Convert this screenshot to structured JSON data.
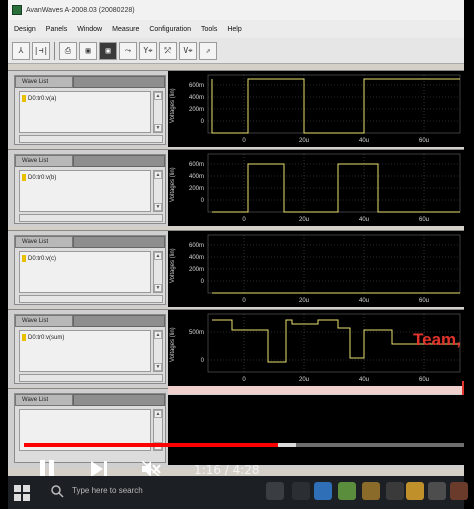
{
  "window": {
    "title": "AvanWaves A-2008.03 (20080228)"
  },
  "menu": [
    "Design",
    "Panels",
    "Window",
    "Measure",
    "Configuration",
    "Tools",
    "Help"
  ],
  "toolbar": {
    "buttons": [
      {
        "icon": "design-icon",
        "glyph": "⅄"
      },
      {
        "icon": "measure-icon",
        "glyph": "|⊣|"
      },
      {
        "icon": "printer-icon",
        "glyph": "⎙"
      },
      {
        "icon": "panel-icon",
        "glyph": "▣"
      },
      {
        "icon": "panel-dark-icon",
        "glyph": "▣"
      },
      {
        "icon": "probe-icon",
        "glyph": "⤳"
      },
      {
        "icon": "marker-y-icon",
        "glyph": "Y⌖"
      },
      {
        "icon": "marker-x-icon",
        "glyph": "⤱"
      },
      {
        "icon": "marker-v-icon",
        "glyph": "V⌖"
      },
      {
        "icon": "pointer-icon",
        "glyph": "⇗"
      }
    ]
  },
  "panels": [
    {
      "wave_list_label": "Wave List",
      "signal": "D0:tr0:v(a)",
      "ylabel": "Voltages (lin)",
      "yticks": [
        "600m",
        "400m",
        "200m",
        "0"
      ],
      "xticks": [
        "0",
        "20u",
        "40u",
        "60u"
      ]
    },
    {
      "wave_list_label": "Wave List",
      "signal": "D0:tr0:v(b)",
      "ylabel": "Voltages (lin)",
      "yticks": [
        "600m",
        "400m",
        "200m",
        "0"
      ],
      "xticks": [
        "0",
        "20u",
        "40u",
        "60u"
      ]
    },
    {
      "wave_list_label": "Wave List",
      "signal": "D0:tr0:v(c)",
      "ylabel": "Voltages (lin)",
      "yticks": [
        "600m",
        "400m",
        "200m",
        "0"
      ],
      "xticks": [
        "0",
        "20u",
        "40u",
        "60u"
      ]
    },
    {
      "wave_list_label": "Wave List",
      "signal": "D0:tr0:v(sum)",
      "ylabel": "Voltages (lin)",
      "yticks": [
        "500m",
        "0"
      ],
      "xticks": [
        "0",
        "20u",
        "40u",
        "60u"
      ]
    },
    {
      "wave_list_label": "Wave List",
      "signal": "",
      "ylabel": "",
      "yticks": [],
      "xticks": []
    }
  ],
  "video": {
    "overlay_text": "Team,",
    "time": "1:16 / 4:28",
    "progress_fraction": 0.577,
    "colors": {
      "progress": "#ff0000",
      "overlay_text": "#e0342c"
    }
  },
  "taskbar": {
    "search_placeholder": "Type here to search"
  },
  "colors": {
    "waveform": "#e8e070",
    "plot_bg": "#000000",
    "panel_bg": "#cfcfcf"
  }
}
